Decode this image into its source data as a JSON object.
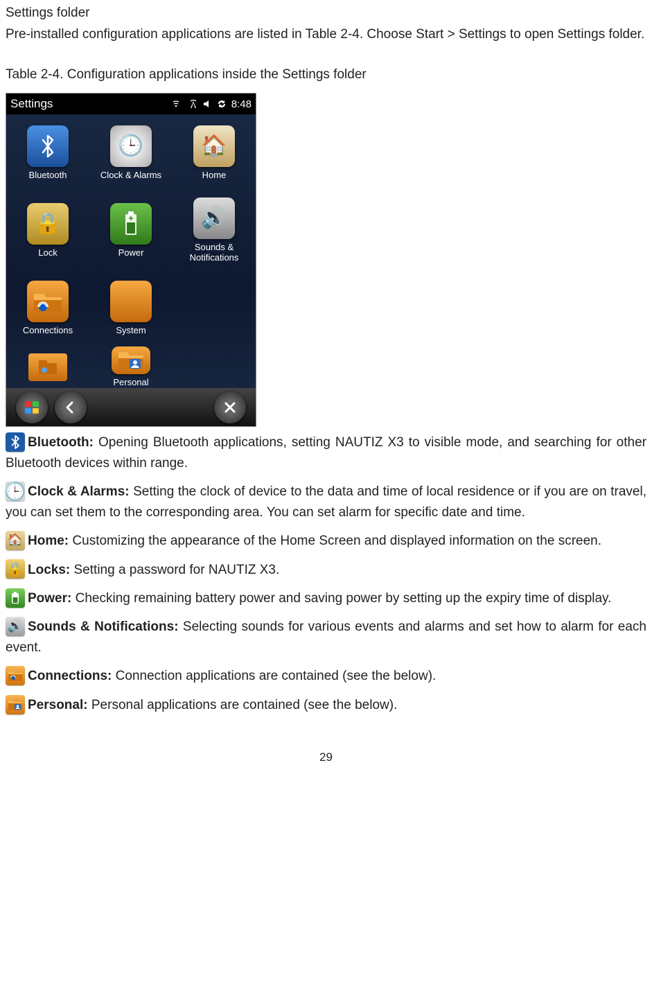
{
  "heading": "Settings folder",
  "intro": "Pre-installed configuration applications are listed in Table 2-4.   Choose Start > Settings to open Settings folder.",
  "table_title": "Table 2-4. Configuration applications inside the Settings folder",
  "screenshot": {
    "title": "Settings",
    "time": "8:48",
    "icons": {
      "bluetooth": "Bluetooth",
      "clock_alarms": "Clock & Alarms",
      "home": "Home",
      "lock": "Lock",
      "power": "Power",
      "sounds": "Sounds & Notifications",
      "connections": "Connections",
      "system": "System",
      "personal": "Personal"
    }
  },
  "items": {
    "bluetooth": {
      "title": "Bluetooth:",
      "desc": " Opening Bluetooth applications, setting NAUTIZ X3 to visible mode, and searching for other Bluetooth devices within range."
    },
    "clock": {
      "title": "Clock & Alarms:",
      "desc": " Setting the clock of device to the data and time of local residence or if you are on travel, you can set them to the corresponding area. You can set alarm for specific date and time."
    },
    "home": {
      "title": "Home:",
      "desc": " Customizing the appearance of the Home Screen and displayed information on the screen."
    },
    "locks": {
      "title": "Locks:",
      "desc": " Setting a password for NAUTIZ X3."
    },
    "power": {
      "title": "Power:",
      "desc": " Checking remaining battery power and saving power by setting up the expiry time of display."
    },
    "sounds": {
      "title": "Sounds & Notifications:",
      "desc": " Selecting sounds for various events and alarms and set how to alarm for each event."
    },
    "connections": {
      "title": "Connections:",
      "desc": " Connection applications are contained (see the below)."
    },
    "personal": {
      "title": "Personal:",
      "desc": " Personal applications are contained (see the below)."
    }
  },
  "page_number": "29"
}
